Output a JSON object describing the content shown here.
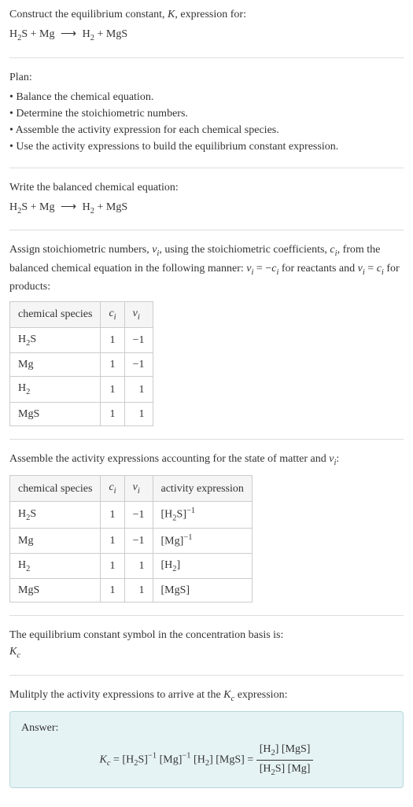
{
  "intro": {
    "line1_prefix": "Construct the equilibrium constant, ",
    "line1_K": "K",
    "line1_suffix": ", expression for:",
    "reaction_lhs1": "H",
    "reaction_lhs1_sub": "2",
    "reaction_lhs1_suffix": "S + Mg",
    "reaction_arrow": "⟶",
    "reaction_rhs1": "H",
    "reaction_rhs1_sub": "2",
    "reaction_rhs1_suffix": " + MgS"
  },
  "plan": {
    "title": "Plan:",
    "b1": "• Balance the chemical equation.",
    "b2": "• Determine the stoichiometric numbers.",
    "b3": "• Assemble the activity expression for each chemical species.",
    "b4": "• Use the activity expressions to build the equilibrium constant expression."
  },
  "balanced": {
    "title": "Write the balanced chemical equation:"
  },
  "stoich": {
    "text_p1": "Assign stoichiometric numbers, ",
    "nu_i": "ν",
    "nu_i_sub": "i",
    "text_p2": ", using the stoichiometric coefficients, ",
    "c_i": "c",
    "c_i_sub": "i",
    "text_p3": ", from the balanced chemical equation in the following manner: ",
    "eq1": "ν",
    "eq1_sub": "i",
    "eq1_mid": " = −",
    "eq1_c": "c",
    "eq1_csub": "i",
    "text_p4": " for reactants and ",
    "eq2": "ν",
    "eq2_sub": "i",
    "eq2_mid": " = ",
    "eq2_c": "c",
    "eq2_csub": "i",
    "text_p5": " for products:",
    "table": {
      "h1": "chemical species",
      "h2": "c",
      "h2_sub": "i",
      "h3": "ν",
      "h3_sub": "i",
      "rows": [
        {
          "species_p1": "H",
          "species_sub": "2",
          "species_p2": "S",
          "c": "1",
          "nu": "−1"
        },
        {
          "species_p1": "Mg",
          "species_sub": "",
          "species_p2": "",
          "c": "1",
          "nu": "−1"
        },
        {
          "species_p1": "H",
          "species_sub": "2",
          "species_p2": "",
          "c": "1",
          "nu": "1"
        },
        {
          "species_p1": "MgS",
          "species_sub": "",
          "species_p2": "",
          "c": "1",
          "nu": "1"
        }
      ]
    }
  },
  "activity": {
    "text_p1": "Assemble the activity expressions accounting for the state of matter and ",
    "nu": "ν",
    "nu_sub": "i",
    "text_p2": ":",
    "table": {
      "h1": "chemical species",
      "h2": "c",
      "h2_sub": "i",
      "h3": "ν",
      "h3_sub": "i",
      "h4": "activity expression",
      "rows": [
        {
          "species_p1": "H",
          "species_sub": "2",
          "species_p2": "S",
          "c": "1",
          "nu": "−1",
          "expr_p1": "[H",
          "expr_sub": "2",
          "expr_p2": "S]",
          "expr_sup": "−1"
        },
        {
          "species_p1": "Mg",
          "species_sub": "",
          "species_p2": "",
          "c": "1",
          "nu": "−1",
          "expr_p1": "[Mg]",
          "expr_sub": "",
          "expr_p2": "",
          "expr_sup": "−1"
        },
        {
          "species_p1": "H",
          "species_sub": "2",
          "species_p2": "",
          "c": "1",
          "nu": "1",
          "expr_p1": "[H",
          "expr_sub": "2",
          "expr_p2": "]",
          "expr_sup": ""
        },
        {
          "species_p1": "MgS",
          "species_sub": "",
          "species_p2": "",
          "c": "1",
          "nu": "1",
          "expr_p1": "[MgS]",
          "expr_sub": "",
          "expr_p2": "",
          "expr_sup": ""
        }
      ]
    }
  },
  "concbasis": {
    "text": "The equilibrium constant symbol in the concentration basis is:",
    "K": "K",
    "K_sub": "c"
  },
  "multiply": {
    "text_p1": "Mulitply the activity expressions to arrive at the ",
    "K": "K",
    "K_sub": "c",
    "text_p2": " expression:"
  },
  "answer": {
    "label": "Answer:",
    "K": "K",
    "K_sub": "c",
    "eq_mid": " = [H",
    "h2s_sub": "2",
    "h2s_end": "S]",
    "neg1a": "−1",
    "mg": " [Mg]",
    "neg1b": "−1",
    "h2": " [H",
    "h2_sub": "2",
    "h2_end": "]",
    "mgs": " [MgS] = ",
    "num_p1": "[H",
    "num_sub": "2",
    "num_p2": "] [MgS]",
    "den_p1": "[H",
    "den_sub": "2",
    "den_p2": "S] [Mg]"
  }
}
